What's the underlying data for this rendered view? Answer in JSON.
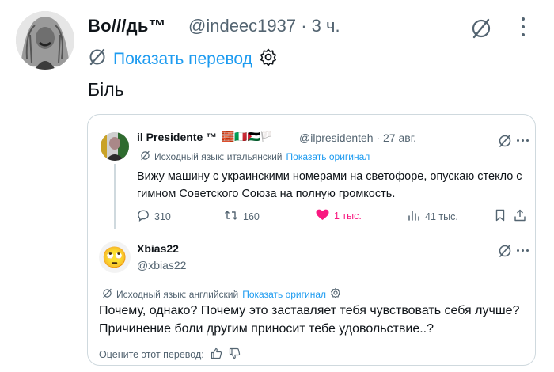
{
  "post": {
    "author_name": "Во///дь™",
    "handle_time": "@indeec1937 · 3 ч.",
    "translate_label": "Показать перевод",
    "text": "Біль",
    "grok_icon": "grok-icon",
    "more_icon": "more-vertical-icon",
    "settings_icon": "gear-icon"
  },
  "quote": {
    "author_name": "il Presidente ™",
    "flags": "🧱🇮🇹🇵🇸🏳️",
    "handle_date": "@ilpresidenteh · 27 авг.",
    "source_prefix": "Исходный язык: итальянский",
    "source_link": "Показать оригинал",
    "text": "Вижу машину с украинскими номерами на светофоре, опускаю стекло с гимном Советского Союза на полную громкость.",
    "actions": {
      "replies": "310",
      "reposts": "160",
      "likes": "1 тыс.",
      "views": "41 тыс."
    }
  },
  "reply": {
    "author_name": "Xbias22",
    "handle": "@xbias22",
    "avatar_emoji": "🙄",
    "source_prefix": "Исходный язык: английский",
    "source_link": "Показать оригинал",
    "text": "Почему, однако? Почему это заставляет тебя чувствовать себя лучше? Причинение боли другим приносит тебе удовольствие..?",
    "rate_label": "Оцените этот перевод:"
  },
  "colors": {
    "accent": "#1d9bf0",
    "like": "#f91880",
    "secondary_text": "#536471",
    "border": "#cfd9de"
  }
}
